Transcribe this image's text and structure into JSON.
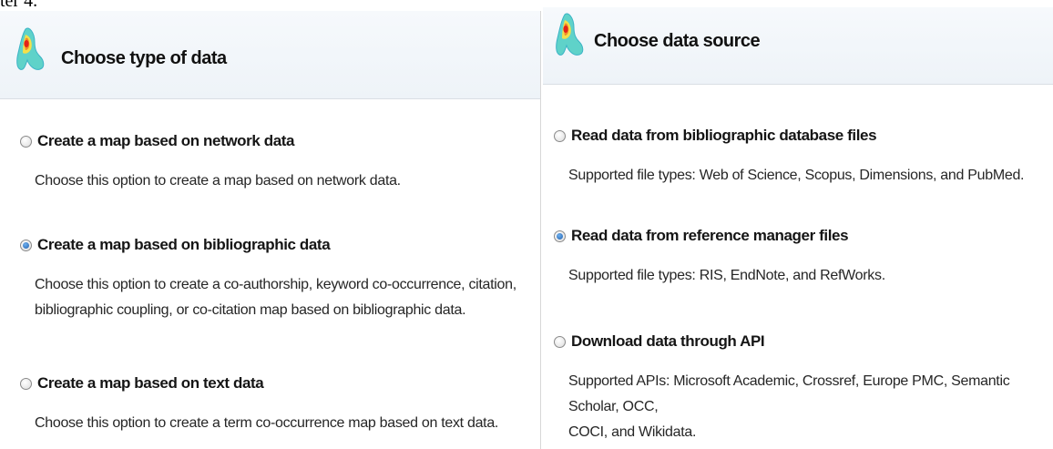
{
  "caption": "ter 4.",
  "left_panel": {
    "title": "Choose type of data",
    "options": [
      {
        "label": "Create a map based on network data",
        "selected": false,
        "description": [
          "Choose this option to create a map based on network data."
        ]
      },
      {
        "label": "Create a map based on bibliographic data",
        "selected": true,
        "description": [
          "Choose this option to create a co-authorship, keyword co-occurrence, citation,",
          "bibliographic coupling, or co-citation map based on bibliographic data."
        ]
      },
      {
        "label": "Create a map based on text data",
        "selected": false,
        "description": [
          "Choose this option to create a term co-occurrence map based on text data."
        ]
      }
    ]
  },
  "right_panel": {
    "title": "Choose data source",
    "options": [
      {
        "label": "Read data from bibliographic database files",
        "selected": false,
        "description": [
          "Supported file types: Web of Science, Scopus, Dimensions, and PubMed."
        ]
      },
      {
        "label": "Read data from reference manager files",
        "selected": true,
        "description": [
          "Supported file types: RIS, EndNote, and RefWorks."
        ]
      },
      {
        "label": "Download data through API",
        "selected": false,
        "description": [
          "Supported APIs: Microsoft Academic, Crossref, Europe PMC, Semantic Scholar, OCC,",
          "COCI, and Wikidata."
        ]
      }
    ]
  },
  "colors": {
    "accent_radio": "#1f5fae",
    "header_bg": "#eef3f8",
    "divider": "#d7d7d7"
  },
  "icons": {
    "logo": "vosviewer-logo-icon",
    "radio": "radio-button-icon"
  }
}
